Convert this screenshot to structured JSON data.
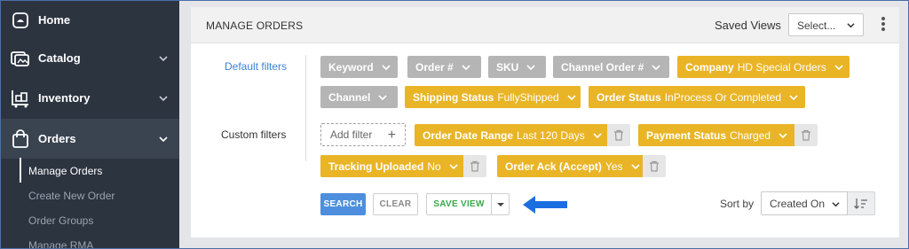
{
  "sidebar": {
    "items": [
      {
        "label": "Home",
        "icon": "home-icon"
      },
      {
        "label": "Catalog",
        "icon": "catalog-icon"
      },
      {
        "label": "Inventory",
        "icon": "inventory-icon"
      },
      {
        "label": "Orders",
        "icon": "orders-icon"
      }
    ],
    "sub_items": [
      "Manage Orders",
      "Create New Order",
      "Order Groups",
      "Manage RMA"
    ],
    "active_item": "Orders",
    "active_sub_item": "Manage Orders"
  },
  "header": {
    "title": "MANAGE ORDERS",
    "saved_views_label": "Saved Views",
    "saved_views_select": "Select..."
  },
  "filters": {
    "default_label": "Default filters",
    "custom_label": "Custom filters",
    "default_chips": [
      {
        "label": "Keyword",
        "value": "",
        "style": "gray"
      },
      {
        "label": "Order #",
        "value": "",
        "style": "gray"
      },
      {
        "label": "SKU",
        "value": "",
        "style": "gray"
      },
      {
        "label": "Channel Order #",
        "value": "",
        "style": "gray"
      },
      {
        "label": "Company",
        "value": "HD Special Orders",
        "style": "yellow"
      },
      {
        "label": "Channel",
        "value": "",
        "style": "gray"
      },
      {
        "label": "Shipping Status",
        "value": "FullyShipped",
        "style": "yellow"
      },
      {
        "label": "Order Status",
        "value": "InProcess Or Completed",
        "style": "yellow"
      }
    ],
    "add_filter_label": "Add filter",
    "custom_chips": [
      {
        "label": "Order Date Range",
        "value": "Last 120 Days"
      },
      {
        "label": "Payment Status",
        "value": "Charged"
      },
      {
        "label": "Tracking Uploaded",
        "value": "No"
      },
      {
        "label": "Order Ack (Accept)",
        "value": "Yes"
      }
    ]
  },
  "actions": {
    "search": "SEARCH",
    "clear": "CLEAR",
    "save_view": "SAVE VIEW"
  },
  "sort": {
    "label": "Sort by",
    "value": "Created On"
  },
  "colors": {
    "sidebar_bg": "#2c3440",
    "chip_gray": "#b5b5b5",
    "chip_yellow": "#e9b426",
    "link_blue": "#3b82d6",
    "search_blue": "#4e8fdd",
    "save_green": "#3aa84a",
    "arrow_blue": "#1a6ee0"
  }
}
